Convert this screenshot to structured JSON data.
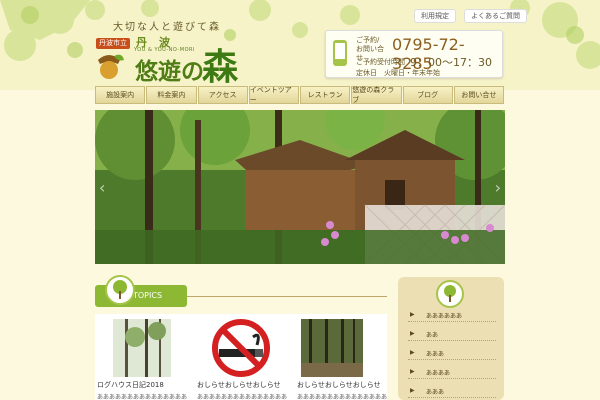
{
  "header": {
    "tagline": "大切な人と遊びて森",
    "city_badge": "丹波市立",
    "place": "丹波",
    "romaji": "YOU & YOU-NO-MORI",
    "name_prefix": "悠遊の",
    "name_mori": "森",
    "links": [
      "利用規定",
      "よくあるご質問"
    ]
  },
  "contact": {
    "label": "ご予約/お問い合せ",
    "phone": "0795-72-3285",
    "hours_label": "ご予約受付時間",
    "hours": "9：00～17：30",
    "closed": "定休日　火曜日・年末年始"
  },
  "nav": [
    "施設案内",
    "料金案内",
    "アクセス",
    "イベントツアー",
    "レストラン",
    "悠遊の森クラブ",
    "ブログ",
    "お問い合せ"
  ],
  "hero": {
    "prev_arrow": "‹",
    "next_arrow": "›"
  },
  "topics": {
    "label": "TOPICS",
    "cards": [
      {
        "title": "ログハウス日記2018",
        "desc": "ああああああああああああああああ"
      },
      {
        "title": "おしらせおしらせおしらせ",
        "desc": "ああああああああああああああああ"
      },
      {
        "title": "おしらせおしらせおしらせ",
        "desc": "ああああああああああああああああ"
      }
    ]
  },
  "sidebar": {
    "items": [
      "ああああああ",
      "ああ",
      "あああ",
      "ああああ",
      "あああ"
    ]
  },
  "colors": {
    "accent_green": "#8db834",
    "background": "#fdf9df",
    "logo_green": "#4f7d16",
    "phone_brown": "#8c5e1e"
  }
}
